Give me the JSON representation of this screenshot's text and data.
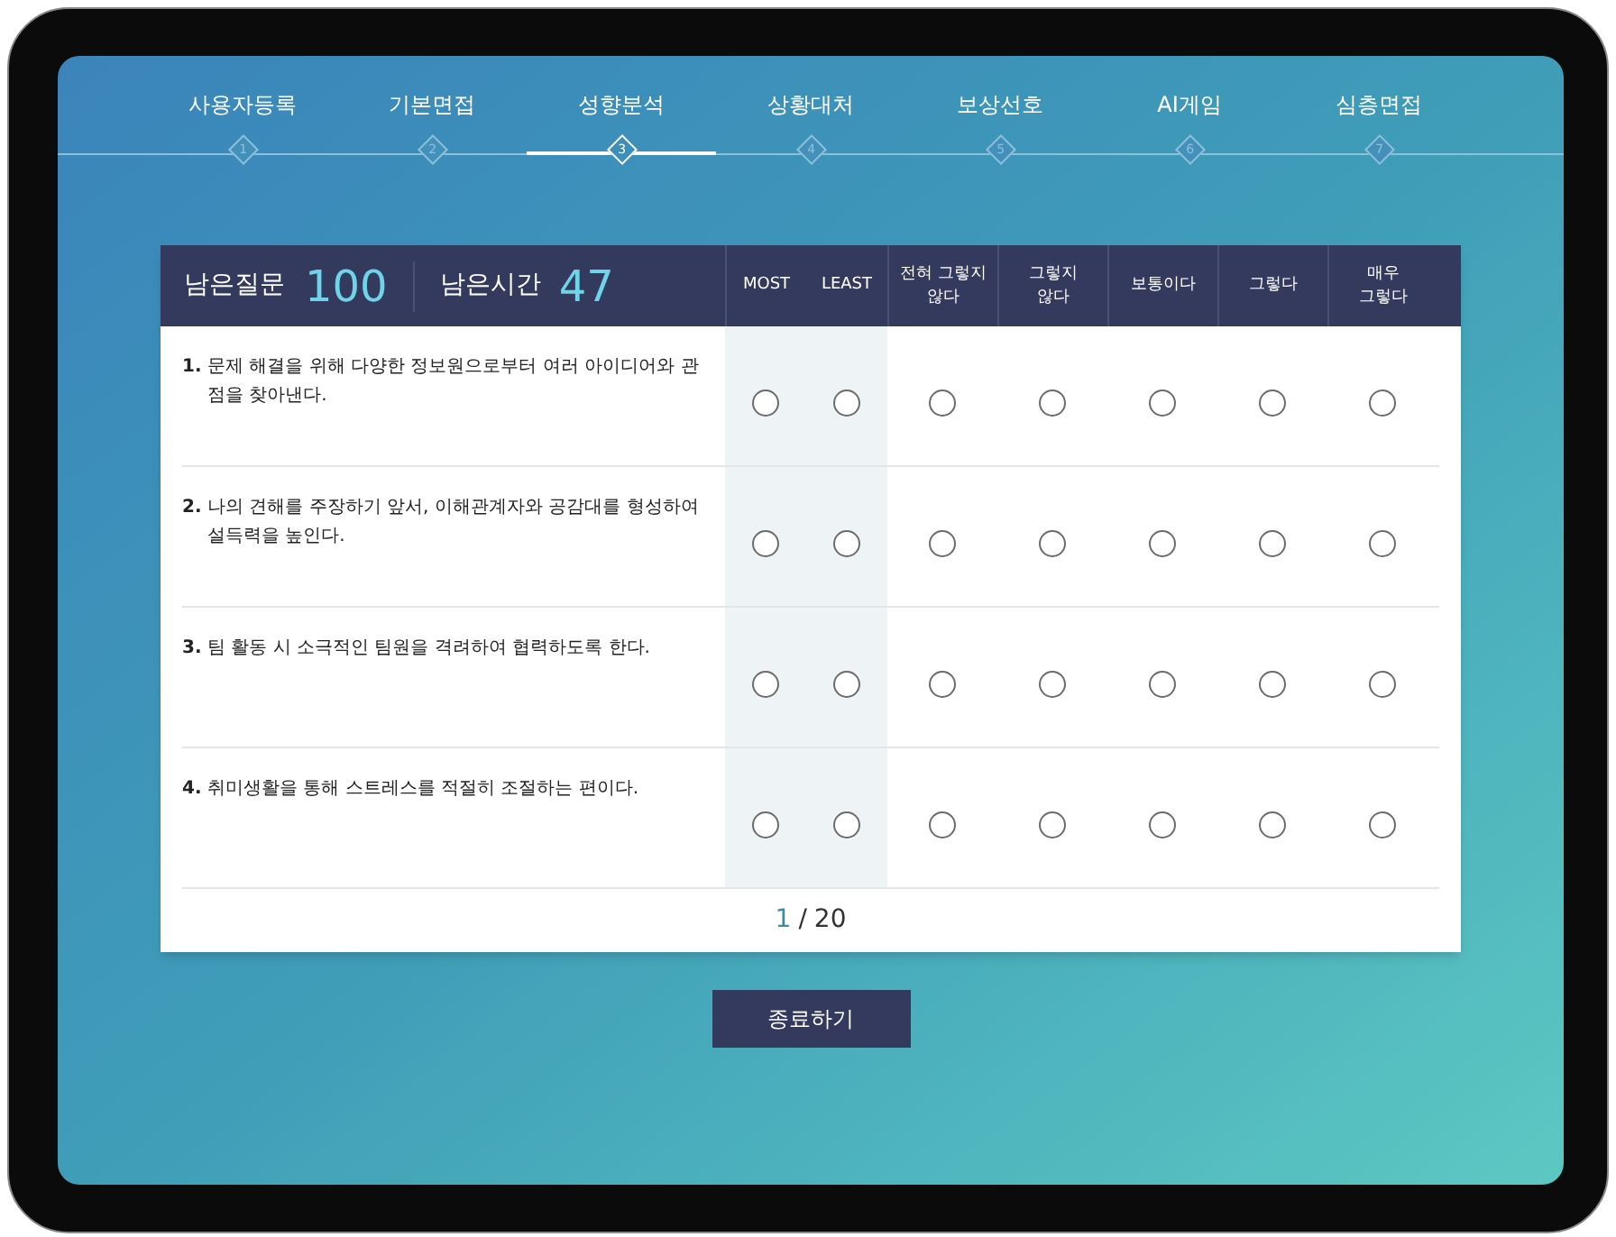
{
  "steps": [
    {
      "label": "사용자등록",
      "number": "1",
      "selected": false
    },
    {
      "label": "기본면접",
      "number": "2",
      "selected": false
    },
    {
      "label": "성향분석",
      "number": "3",
      "selected": true
    },
    {
      "label": "상황대처",
      "number": "4",
      "selected": false
    },
    {
      "label": "보상선호",
      "number": "5",
      "selected": false
    },
    {
      "label": "AI게임",
      "number": "6",
      "selected": false
    },
    {
      "label": "심층면접",
      "number": "7",
      "selected": false
    }
  ],
  "header": {
    "remaining_questions_label": "남은질문",
    "remaining_questions": "100",
    "remaining_time_label": "남은시간",
    "remaining_time": "47"
  },
  "columns": [
    {
      "label": "MOST",
      "kind": "pick"
    },
    {
      "label": "LEAST",
      "kind": "pick"
    },
    {
      "label": "전혀 그렇지\n않다",
      "kind": "scale"
    },
    {
      "label": "그렇지\n않다",
      "kind": "scale"
    },
    {
      "label": "보통이다",
      "kind": "scale"
    },
    {
      "label": "그렇다",
      "kind": "scale"
    },
    {
      "label": "매우\n그렇다",
      "kind": "scale"
    }
  ],
  "questions": [
    {
      "number": "1.",
      "text": "문제 해결을 위해 다양한 정보원으로부터 여러 아이디어와 관점을 찾아낸다.",
      "options": [
        {
          "selected": false
        },
        {
          "selected": false
        },
        {
          "selected": false
        },
        {
          "selected": false
        },
        {
          "selected": false
        },
        {
          "selected": false
        },
        {
          "selected": false
        }
      ]
    },
    {
      "number": "2.",
      "text": "나의 견해를 주장하기 앞서, 이해관계자와 공감대를 형성하여 설득력을 높인다.",
      "options": [
        {
          "selected": false
        },
        {
          "selected": false
        },
        {
          "selected": false
        },
        {
          "selected": false
        },
        {
          "selected": false
        },
        {
          "selected": false
        },
        {
          "selected": false
        }
      ]
    },
    {
      "number": "3.",
      "text": "팀 활동 시 소극적인 팀원을 격려하여 협력하도록 한다.",
      "options": [
        {
          "selected": false
        },
        {
          "selected": false
        },
        {
          "selected": false
        },
        {
          "selected": false
        },
        {
          "selected": false
        },
        {
          "selected": false
        },
        {
          "selected": false
        }
      ]
    },
    {
      "number": "4.",
      "text": "취미생활을 통해 스트레스를 적절히 조절하는 편이다.",
      "options": [
        {
          "selected": false
        },
        {
          "selected": false
        },
        {
          "selected": false
        },
        {
          "selected": false
        },
        {
          "selected": false
        },
        {
          "selected": false
        },
        {
          "selected": false
        }
      ]
    }
  ],
  "pagination": {
    "current": "1",
    "separator": "/",
    "total": "20"
  },
  "finish_button": "종료하기"
}
